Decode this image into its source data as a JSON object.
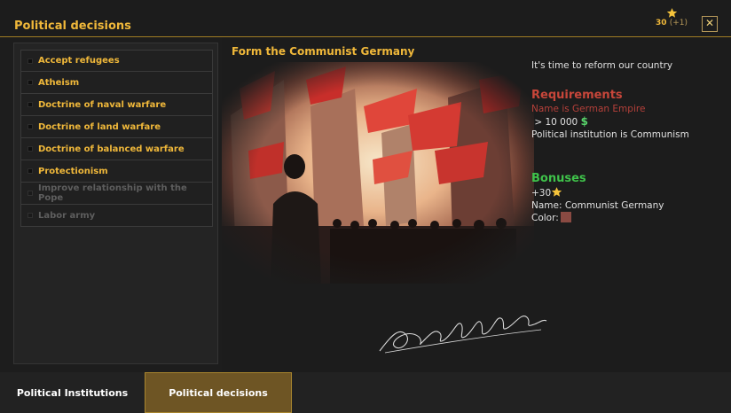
{
  "header": {
    "title": "Political decisions",
    "stars_value": "30",
    "stars_bonus": "(+1)",
    "close_label": "✕"
  },
  "decisions": [
    {
      "label": "Accept refugees",
      "state": "active"
    },
    {
      "label": "Atheism",
      "state": "active"
    },
    {
      "label": "Doctrine of naval warfare",
      "state": "active"
    },
    {
      "label": "Doctrine of land warfare",
      "state": "active"
    },
    {
      "label": "Doctrine of balanced warfare",
      "state": "active"
    },
    {
      "label": "Protectionism",
      "state": "active"
    },
    {
      "label": "Improve relationship with the Pope",
      "state": "disabled"
    },
    {
      "label": "Labor army",
      "state": "disabled"
    }
  ],
  "detail": {
    "title": "Form the Communist Germany",
    "description": "It's time to reform our country",
    "requirements_title": "Requirements",
    "requirements": {
      "name_req": "Name is German Empire",
      "money_req": "> 10 000",
      "money_icon": "$",
      "institution_req": "Political institution is Communism"
    },
    "bonuses_title": "Bonuses",
    "bonuses": {
      "stars": "+30",
      "name": "Name: Communist Germany",
      "color_label": "Color:",
      "color_value": "#8a4a42"
    }
  },
  "tabs": {
    "institutions": "Political Institutions",
    "decisions": "Political decisions"
  },
  "colors": {
    "accent": "#f0b83a",
    "requirements": "#c8463a",
    "bonuses": "#3fc24a",
    "tab_active": "#6e5524"
  }
}
